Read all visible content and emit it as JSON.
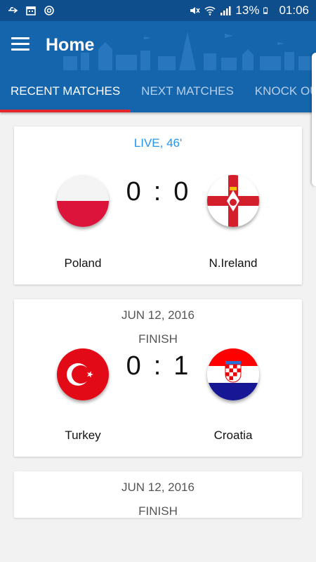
{
  "status_bar": {
    "battery_percent": "13%",
    "time": "01:06",
    "left_icons": [
      "usb-icon",
      "calendar-icon",
      "sync-icon"
    ],
    "right_icons": [
      "mute-icon",
      "wifi-icon",
      "signal-icon",
      "battery-icon"
    ]
  },
  "app_bar": {
    "title": "Home",
    "menu_icon": "hamburger-menu-icon"
  },
  "tabs": [
    {
      "label": "RECENT MATCHES",
      "active": true
    },
    {
      "label": "NEXT MATCHES",
      "active": false
    },
    {
      "label": "KNOCK OUT",
      "active": false
    }
  ],
  "matches": [
    {
      "date": "",
      "status": "LIVE, 46'",
      "home_team": "Poland",
      "away_team": "N.Ireland",
      "home_score": "0",
      "away_score": "0",
      "separator": ":"
    },
    {
      "date": "JUN 12, 2016",
      "status": "FINISH",
      "home_team": "Turkey",
      "away_team": "Croatia",
      "home_score": "0",
      "away_score": "1",
      "separator": ":"
    },
    {
      "date": "JUN 12, 2016",
      "status": "FINISH"
    }
  ],
  "colors": {
    "primary": "#1565ad",
    "status_bar": "#0f4e8c",
    "tab_indicator": "#e4262d",
    "live": "#2196f3"
  }
}
